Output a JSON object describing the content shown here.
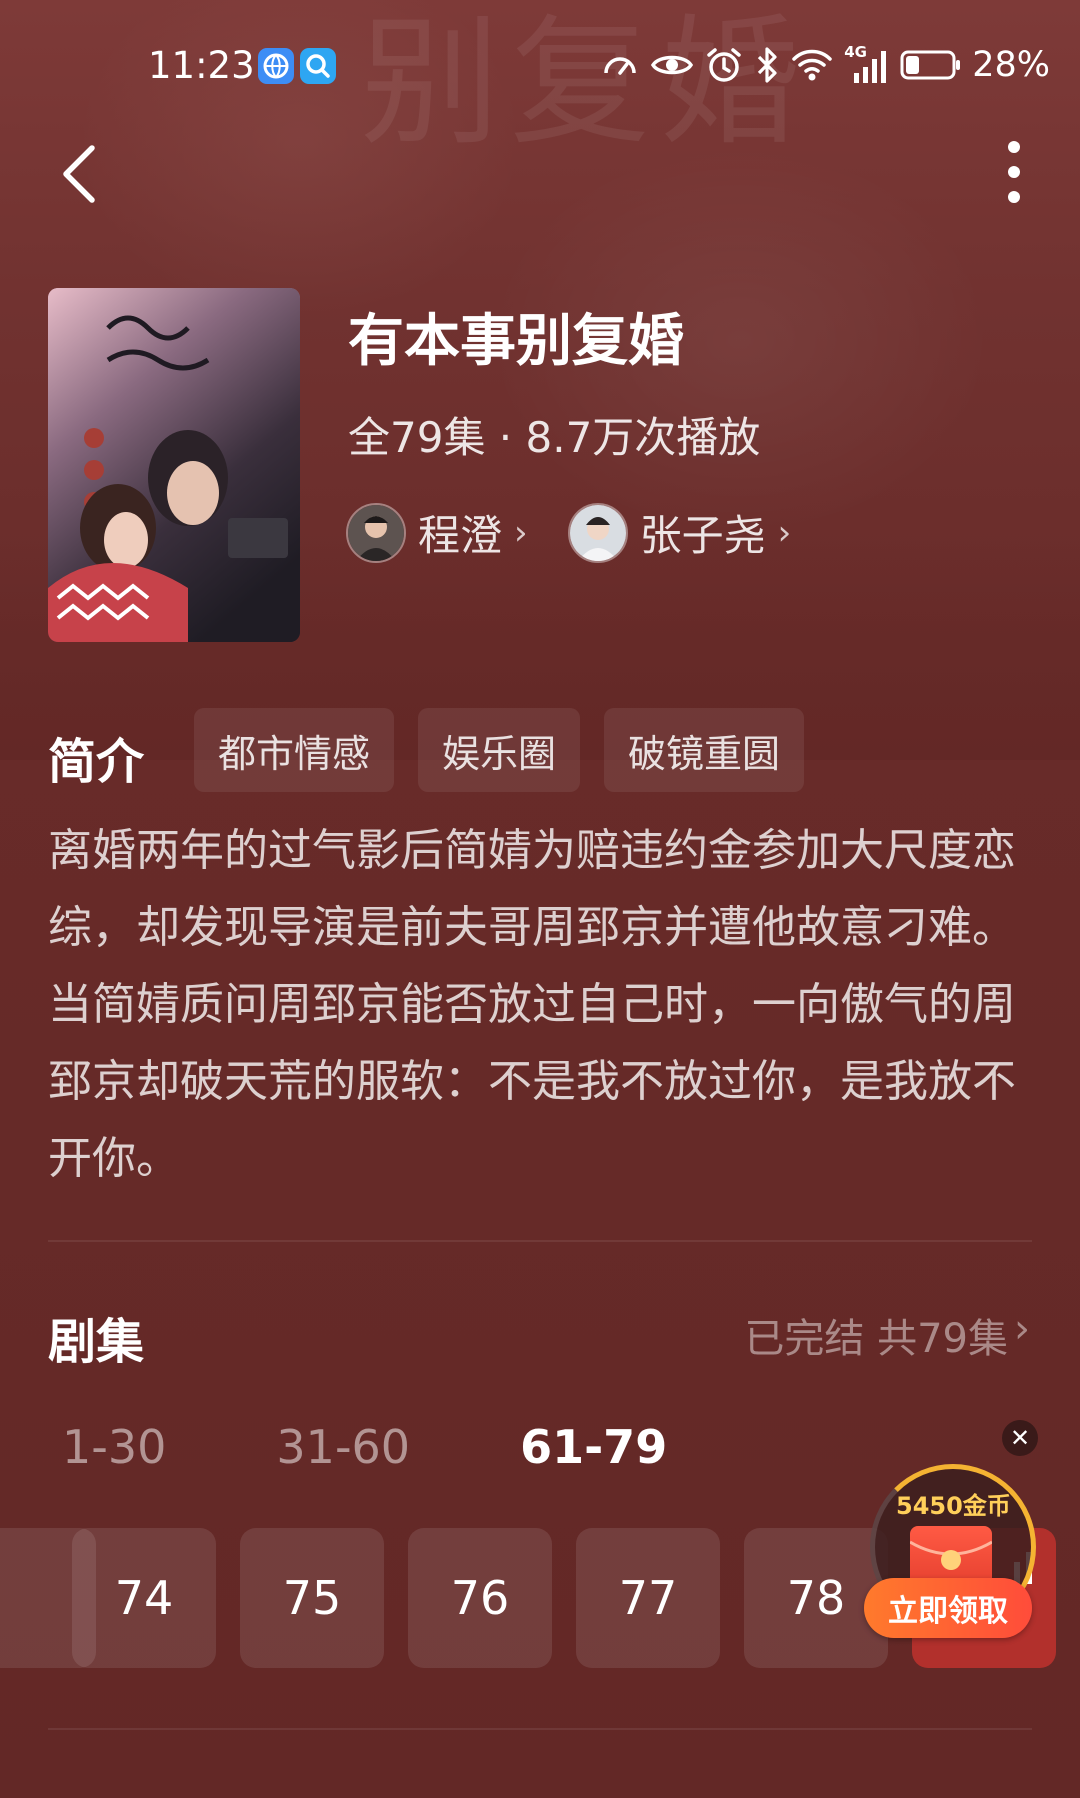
{
  "status_bar": {
    "time": "11:23",
    "battery_text": "28%",
    "network_label": "4G",
    "icons": [
      "browser-app-icon",
      "search-app-icon",
      "speedometer-icon",
      "eye-icon",
      "alarm-icon",
      "bluetooth-icon",
      "wifi-icon",
      "signal-icon",
      "battery-icon"
    ]
  },
  "drama": {
    "title": "有本事别复婚",
    "meta": "全79集 · 8.7万次播放",
    "cast": [
      {
        "name": "程澄"
      },
      {
        "name": "张子尧"
      }
    ]
  },
  "intro": {
    "heading": "简介",
    "tags": [
      "都市情感",
      "娱乐圈",
      "破镜重圆"
    ],
    "synopsis": "离婚两年的过气影后简婧为赔违约金参加大尺度恋综，却发现导演是前夫哥周郅京并遭他故意刁难。当简婧质问周郅京能否放过自己时，一向傲气的周郅京却破天荒的服软：不是我不放过你，是我放不开你。"
  },
  "episodes": {
    "heading": "剧集",
    "status": "已完结 共79集",
    "ranges": [
      "1-30",
      "31-60",
      "61-79"
    ],
    "active_range": "61-79",
    "visible": [
      "74",
      "75",
      "76",
      "77",
      "78"
    ],
    "current": "79"
  },
  "promo": {
    "coins": "5450金币",
    "button": "立即领取"
  },
  "colors": {
    "background": "#682b29",
    "accent_red": "#b2302c",
    "promo_orange": "#ff5a35",
    "coin_gold": "#ffcf5a"
  }
}
